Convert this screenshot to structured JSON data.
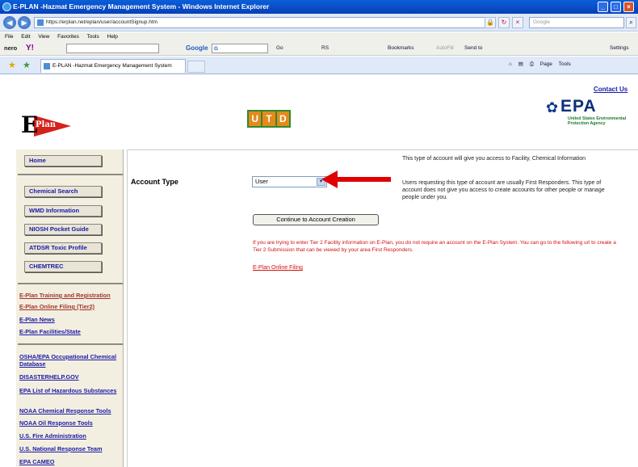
{
  "window": {
    "title": "E-PLAN -Hazmat Emergency Management System - Windows Internet Explorer"
  },
  "browser": {
    "url": "https://erplan.net/eplan/user/accountSignup.htm",
    "search_placeholder": "Google",
    "menu": [
      "File",
      "Edit",
      "View",
      "Favorites",
      "Tools",
      "Help"
    ],
    "toolbar": {
      "nero": "nero",
      "yahoo": "Y!",
      "google": "Google",
      "google_g": "G",
      "go": "Go",
      "rs": "RS",
      "bookmarks": "Bookmarks",
      "autofill": "AutoFill",
      "sendto": "Send to",
      "settings": "Settings"
    },
    "tab_title": "E-PLAN -Hazmat Emergency Management System",
    "right_tools": [
      "Page",
      "Tools"
    ]
  },
  "header": {
    "contact_us": "Contact Us",
    "eplan_logo_letter": "E",
    "eplan_logo_text": "Plan",
    "utd_letters": [
      "U",
      "T",
      "D"
    ],
    "epa_text": "EPA",
    "epa_sub": "United States Environmental Protection Agency"
  },
  "sidebar": {
    "buttons": [
      "Home",
      "Chemical Search",
      "WMD Information",
      "NIOSH Pocket Guide",
      "ATDSR Toxic Profile",
      "CHEMTREC"
    ],
    "links_group1": [
      "E-Plan Training and Registration",
      "E-Plan Online Filing (Tier2)",
      "E-Plan News",
      "E-Plan Facilities/State"
    ],
    "links_group2": [
      "OSHA/EPA Occupational Chemical Database",
      "DISASTERHELP.GOV",
      "EPA List of Hazardous Substances",
      "NOAA Chemical Response Tools",
      "NOAA Oil Response Tools",
      "U.S. Fire Administration",
      "U.S. National Response Team",
      "EPA CAMEO"
    ]
  },
  "main": {
    "account_type_label": "Account Type",
    "account_type_value": "User",
    "info_line1": "This type of account will give you access to Facility, Chemical Information",
    "info_line2": "Users requesting this type of account are usually First Responders. This type of account does not give you access to create accounts for other people or manage people under you.",
    "continue_button": "Continue to Account Creation",
    "notice": "If you are trying to enter Tier 2 Facility information on E-Plan, you do not require an account on the E-Plan System. You can go to the following url to create a Tier 2 Submission that can be viewed by your area First Responders.",
    "efile_link": "E-Plan Online Filing"
  }
}
